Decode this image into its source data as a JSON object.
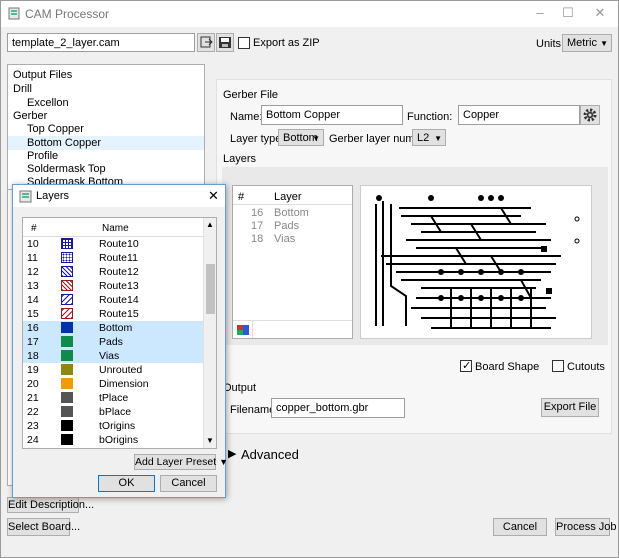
{
  "window": {
    "title": "CAM Processor",
    "controls": [
      "–",
      "☐",
      "✕"
    ]
  },
  "toolbar": {
    "template_file": "template_2_layer.cam",
    "export_zip_label": "Export as ZIP",
    "units_label": "Units:",
    "units_value": "Metric"
  },
  "outputs": {
    "items": [
      {
        "label": "Output Files",
        "indent": 0,
        "selected": false
      },
      {
        "label": "Drill",
        "indent": 0,
        "selected": false
      },
      {
        "label": "Excellon",
        "indent": 1,
        "selected": false
      },
      {
        "label": "Gerber",
        "indent": 0,
        "selected": false
      },
      {
        "label": "Top Copper",
        "indent": 1,
        "selected": false
      },
      {
        "label": "Bottom Copper",
        "indent": 1,
        "selected": true
      },
      {
        "label": "Profile",
        "indent": 1,
        "selected": false
      },
      {
        "label": "Soldermask Top",
        "indent": 1,
        "selected": false
      },
      {
        "label": "Soldermask Bottom",
        "indent": 1,
        "selected": false
      }
    ]
  },
  "gerber": {
    "section_label": "Gerber File",
    "name_label": "Name:",
    "name_value": "Bottom Copper",
    "function_label": "Function:",
    "function_value": "Copper",
    "layer_type_label": "Layer type:",
    "layer_type_value": "Bottom",
    "layer_number_label": "Gerber layer number:",
    "layer_number_value": "L2"
  },
  "layers_panel": {
    "section_label": "Layers",
    "col_num": "#",
    "col_layer": "Layer",
    "rows": [
      {
        "num": "16",
        "name": "Bottom"
      },
      {
        "num": "17",
        "name": "Pads"
      },
      {
        "num": "18",
        "name": "Vias"
      }
    ],
    "board_shape_label": "Board Shape",
    "cutouts_label": "Cutouts"
  },
  "output": {
    "section_label": "Output",
    "filename_label": "Filename:",
    "filename_value": "copper_bottom.gbr",
    "export_file_label": "Export File"
  },
  "advanced_label": "Advanced",
  "footer": {
    "edit_description_label": "Edit Description...",
    "select_board_label": "Select Board...",
    "cancel_label": "Cancel",
    "process_job_label": "Process Job"
  },
  "dialog": {
    "title": "Layers",
    "col_num": "#",
    "col_name": "Name",
    "rows": [
      {
        "num": "10",
        "name": "Route10",
        "color": "#1a1a99",
        "pattern": "grid",
        "highlight": false
      },
      {
        "num": "11",
        "name": "Route11",
        "color": "#1a1a99",
        "pattern": "dots",
        "highlight": false
      },
      {
        "num": "12",
        "name": "Route12",
        "color": "#1a1a99",
        "pattern": "hatch",
        "highlight": false
      },
      {
        "num": "13",
        "name": "Route13",
        "color": "#991a1a",
        "pattern": "hatch",
        "highlight": false
      },
      {
        "num": "14",
        "name": "Route14",
        "color": "#1a1a99",
        "pattern": "hatch2",
        "highlight": false
      },
      {
        "num": "15",
        "name": "Route15",
        "color": "#991a1a",
        "pattern": "hatch2",
        "highlight": false
      },
      {
        "num": "16",
        "name": "Bottom",
        "color": "#0033aa",
        "pattern": "solid",
        "highlight": true
      },
      {
        "num": "17",
        "name": "Pads",
        "color": "#0f8a4a",
        "pattern": "solid",
        "highlight": true
      },
      {
        "num": "18",
        "name": "Vias",
        "color": "#0f8a4a",
        "pattern": "solid",
        "highlight": true
      },
      {
        "num": "19",
        "name": "Unrouted",
        "color": "#8a8a10",
        "pattern": "solid",
        "highlight": false
      },
      {
        "num": "20",
        "name": "Dimension",
        "color": "#f29a0c",
        "pattern": "solid",
        "highlight": false
      },
      {
        "num": "21",
        "name": "tPlace",
        "color": "#555555",
        "pattern": "solid",
        "highlight": false
      },
      {
        "num": "22",
        "name": "bPlace",
        "color": "#555555",
        "pattern": "solid",
        "highlight": false
      },
      {
        "num": "23",
        "name": "tOrigins",
        "color": "#000000",
        "pattern": "solid",
        "highlight": false
      },
      {
        "num": "24",
        "name": "bOrigins",
        "color": "#000000",
        "pattern": "solid",
        "highlight": false
      }
    ],
    "add_preset_label": "Add Layer Preset",
    "ok_label": "OK",
    "cancel_label": "Cancel"
  },
  "icons": [
    "cam-icon",
    "export-icon",
    "save-icon",
    "gear-icon",
    "palette-icon",
    "chevron-right-icon",
    "layers-icon"
  ]
}
